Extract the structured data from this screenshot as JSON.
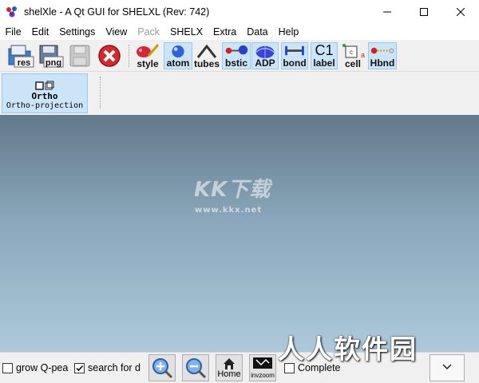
{
  "window": {
    "title": "shelXle - A Qt GUI for SHELXL (Rev: 742)"
  },
  "menu": [
    {
      "label": "File",
      "enabled": true
    },
    {
      "label": "Edit",
      "enabled": true
    },
    {
      "label": "Settings",
      "enabled": true
    },
    {
      "label": "View",
      "enabled": true
    },
    {
      "label": "Pack",
      "enabled": false
    },
    {
      "label": "SHELX",
      "enabled": true
    },
    {
      "label": "Extra",
      "enabled": true
    },
    {
      "label": "Data",
      "enabled": true
    },
    {
      "label": "Help",
      "enabled": true
    }
  ],
  "toolbar": {
    "open_res": "res",
    "save_png": "png",
    "style": "style",
    "atom": "atom",
    "tubes": "tubes",
    "bstic": "bstic",
    "adp": "ADP",
    "bond": "bond",
    "label_top": "C1",
    "label": "label",
    "cell": "cell",
    "cell_axes": "a",
    "hbnd": "Hbnd"
  },
  "toolbar2": {
    "ortho": "Ortho",
    "ortho_sub": "Ortho-projection"
  },
  "watermark": {
    "logo": "KK下载",
    "url": "www.kkx.net",
    "corner": "人人软件园"
  },
  "statusbar": {
    "grow_q": "grow Q-pea",
    "grow_q_checked": false,
    "search_for": "search for d",
    "search_for_checked": true,
    "home": "Home",
    "invzoom": "invzoom",
    "complete": "Complete",
    "complete_checked": false
  },
  "colors": {
    "viewport_top": "#627a8b",
    "viewport_bottom": "#aec9dc",
    "checked_bg": "#cce4f7"
  }
}
